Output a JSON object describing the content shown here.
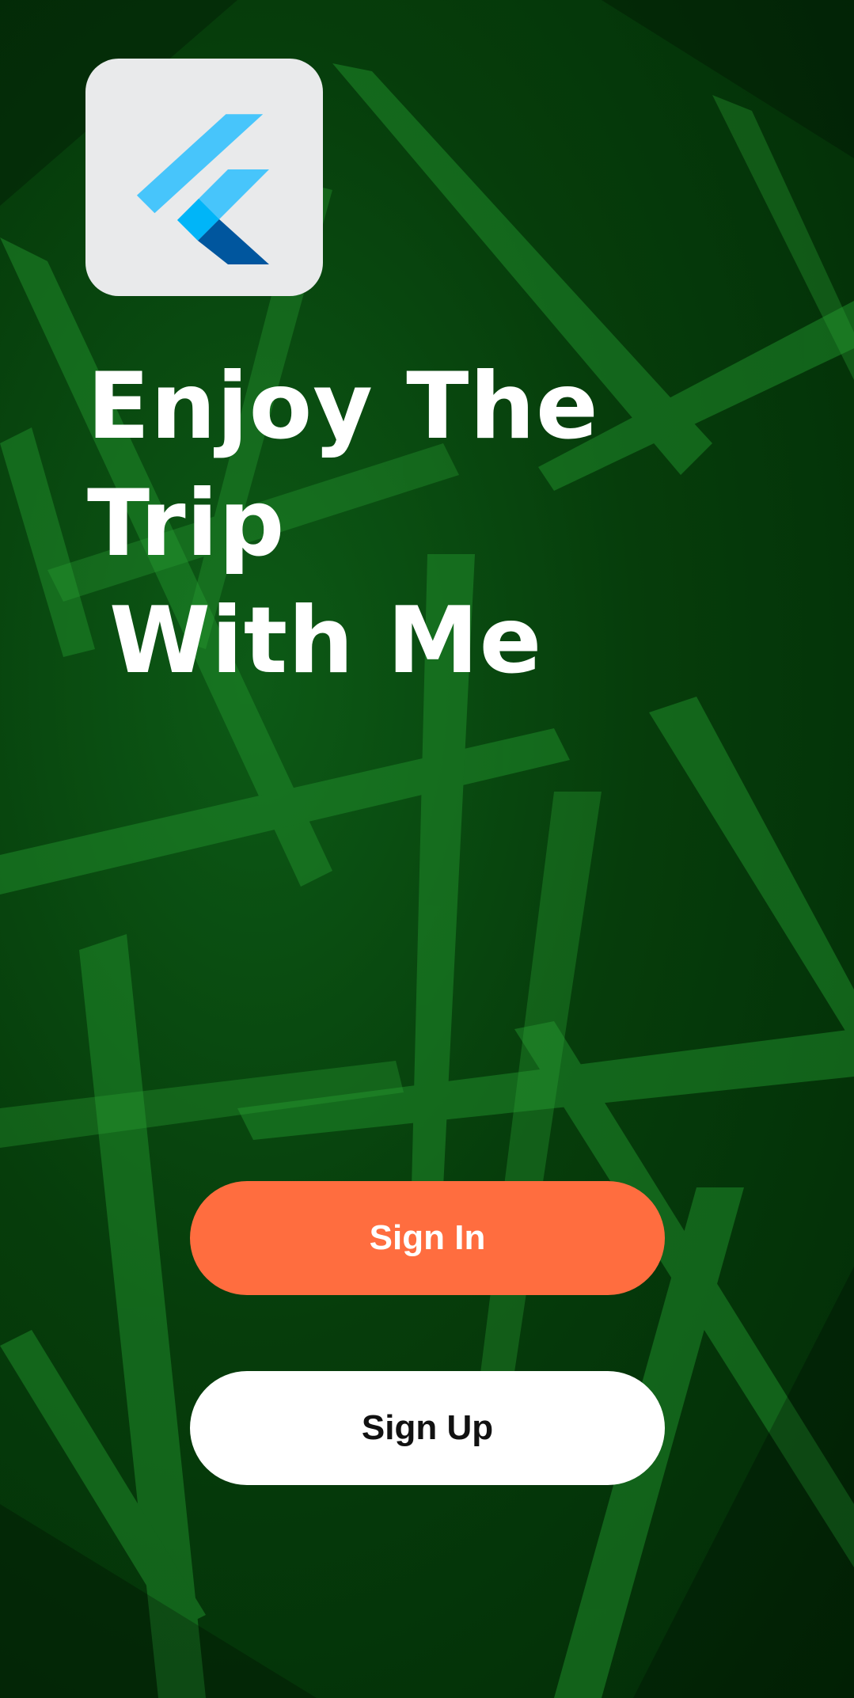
{
  "app": {
    "headline_line1": "Enjoy The Trip",
    "headline_line2": "With Me"
  },
  "logo": {
    "icon": "flutter-logo-icon"
  },
  "actions": {
    "sign_in_label": "Sign In",
    "sign_up_label": "Sign Up"
  },
  "colors": {
    "sign_in_bg": "#ff6d3f",
    "sign_up_bg": "#ffffff",
    "headline": "#ffffff",
    "logo_tile": "#e9eaeb",
    "logo_light_blue": "#47c5fb",
    "logo_mid_blue": "#00b5f8",
    "logo_dark_blue": "#00569e"
  }
}
